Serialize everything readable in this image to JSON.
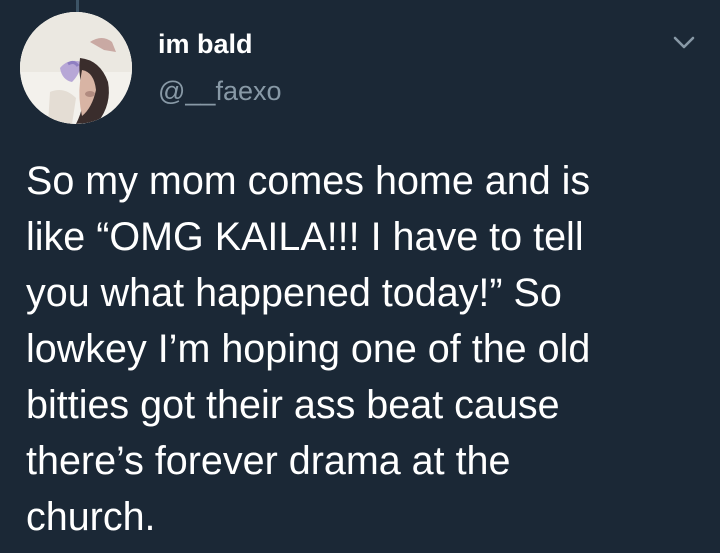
{
  "author": {
    "display_name": "im bald",
    "handle": "@__faexo"
  },
  "icons": {
    "avatar": "profile-photo",
    "menu": "chevron-down-icon"
  },
  "colors": {
    "background": "#1b2836",
    "text": "#ffffff",
    "secondary_text": "#8899a6"
  },
  "tweet": {
    "lines": [
      "So my mom comes home and is",
      "like “OMG KAILA!!! I have to tell",
      "you what happened today!” So",
      "lowkey I’m hoping one of the old",
      "bitties got their ass beat cause",
      "there’s forever drama at the",
      "church."
    ]
  }
}
